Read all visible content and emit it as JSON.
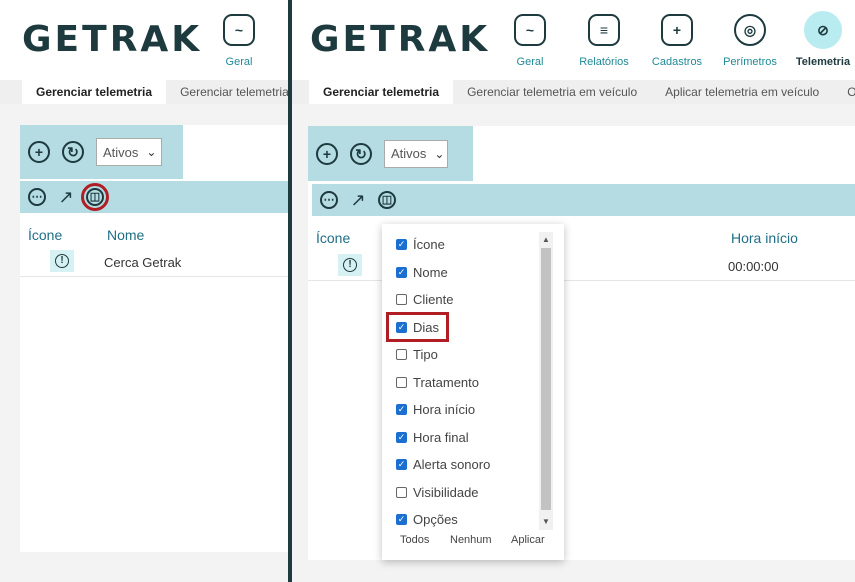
{
  "brand": "GETRAK",
  "left": {
    "nav": [
      {
        "label": "Geral",
        "icon": "monitor-chart-icon"
      }
    ],
    "tabs": [
      "Gerenciar telemetria",
      "Gerenciar telemetria em"
    ],
    "filter_value": "Ativos",
    "columns": [
      "Ícone",
      "Nome"
    ],
    "rows": [
      {
        "name": "Cerca Getrak",
        "icon": "alert-circle-icon"
      }
    ]
  },
  "right": {
    "nav": [
      {
        "label": "Geral",
        "icon": "monitor-chart-icon"
      },
      {
        "label": "Relatórios",
        "icon": "report-icon"
      },
      {
        "label": "Cadastros",
        "icon": "folder-plus-icon"
      },
      {
        "label": "Perímetros",
        "icon": "target-icon"
      },
      {
        "label": "Telemetria",
        "icon": "compass-icon"
      }
    ],
    "tabs": [
      "Gerenciar telemetria",
      "Gerenciar telemetria em veículo",
      "Aplicar telemetria em veículo",
      "Ocor"
    ],
    "filter_value": "Ativos",
    "columns": [
      "Ícone",
      "Hora início"
    ],
    "rows": [
      {
        "time": "00:00:00",
        "icon": "alert-circle-icon"
      }
    ],
    "column_picker": {
      "items": [
        {
          "label": "Ícone",
          "checked": true
        },
        {
          "label": "Nome",
          "checked": true
        },
        {
          "label": "Cliente",
          "checked": false
        },
        {
          "label": "Dias",
          "checked": true
        },
        {
          "label": "Tipo",
          "checked": false
        },
        {
          "label": "Tratamento",
          "checked": false
        },
        {
          "label": "Hora início",
          "checked": true
        },
        {
          "label": "Hora final",
          "checked": true
        },
        {
          "label": "Alerta sonoro",
          "checked": true
        },
        {
          "label": "Visibilidade",
          "checked": false
        },
        {
          "label": "Opções",
          "checked": true
        }
      ],
      "footer": [
        "Todos",
        "Nenhum",
        "Aplicar"
      ]
    }
  },
  "colors": {
    "accent": "#1f8a97",
    "toolbar": "#b4dce2",
    "highlight": "#b01e23",
    "dark": "#1d3a3f",
    "checkbox": "#1b6fd1"
  }
}
